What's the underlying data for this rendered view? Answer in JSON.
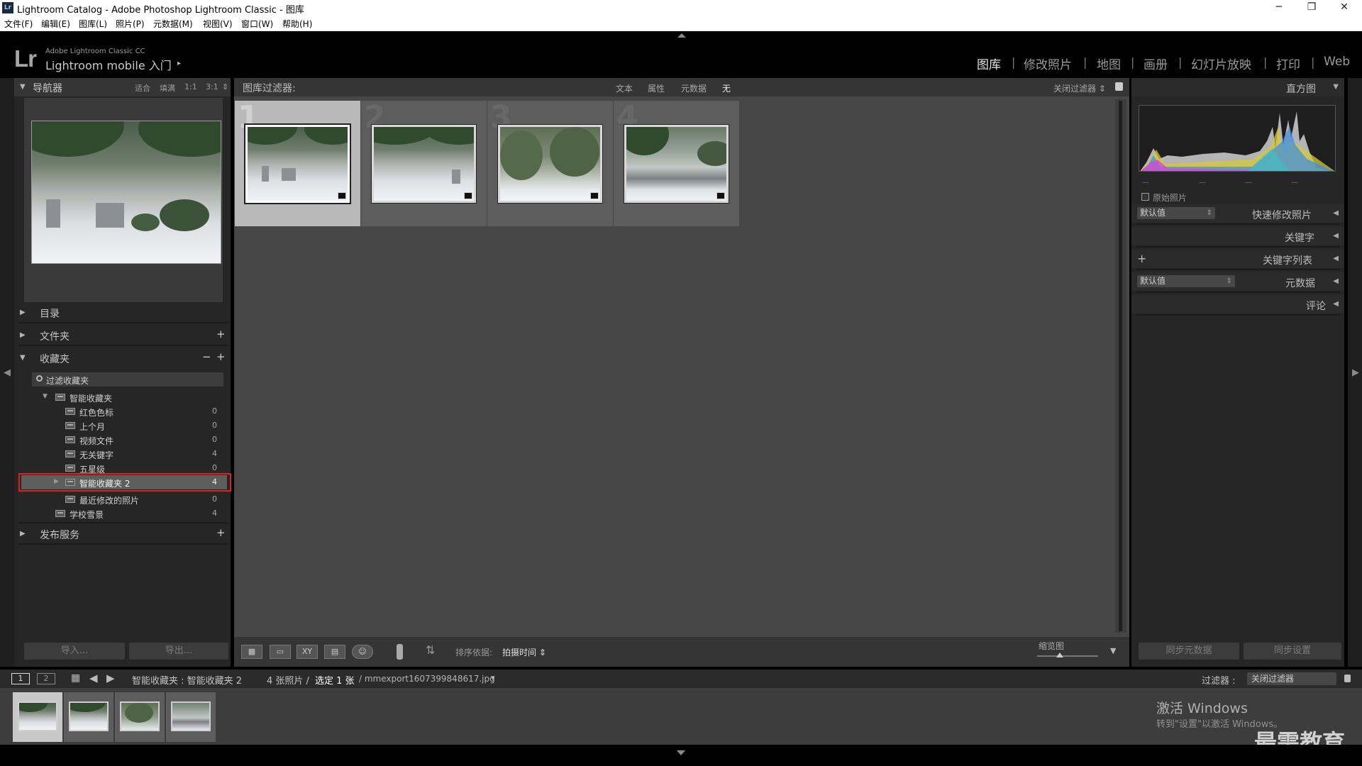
{
  "window": {
    "title": "Lightroom Catalog - Adobe Photoshop Lightroom Classic - 图库",
    "app_icon": "Lr",
    "controls": {
      "minimize": "─",
      "restore": "❐",
      "close": "✕"
    }
  },
  "menu": [
    "文件(F)",
    "编辑(E)",
    "图库(L)",
    "照片(P)",
    "元数据(M)",
    "视图(V)",
    "窗口(W)",
    "帮助(H)"
  ],
  "identity": {
    "logo": "Lr",
    "product": "Adobe Lightroom Classic CC",
    "tagline": "Lightroom mobile 入门",
    "arrow": "▸"
  },
  "modules": [
    {
      "label": "图库",
      "active": true
    },
    {
      "label": "修改照片",
      "active": false
    },
    {
      "label": "地图",
      "active": false
    },
    {
      "label": "画册",
      "active": false
    },
    {
      "label": "幻灯片放映",
      "active": false
    },
    {
      "label": "打印",
      "active": false
    },
    {
      "label": "Web",
      "active": false
    }
  ],
  "module_separator": "|",
  "navigator": {
    "title": "导航器",
    "zoom_options": [
      "适合",
      "填满",
      "1:1",
      "3:1"
    ],
    "stepper": "⇕"
  },
  "left_panels": {
    "catalog": "目录",
    "folders": "文件夹",
    "collections": "收藏夹",
    "publish": "发布服务",
    "plus": "+",
    "minus": "−",
    "collapsed": "▶",
    "expanded": "▼"
  },
  "collections": {
    "filter_label": "过滤收藏夹",
    "items": [
      {
        "name": "智能收藏夹",
        "count": "",
        "level": 0,
        "expanded": true,
        "selected": false
      },
      {
        "name": "红色色标",
        "count": "0",
        "level": 1,
        "selected": false
      },
      {
        "name": "上个月",
        "count": "0",
        "level": 1,
        "selected": false
      },
      {
        "name": "视频文件",
        "count": "0",
        "level": 1,
        "selected": false
      },
      {
        "name": "无关键字",
        "count": "4",
        "level": 1,
        "selected": false
      },
      {
        "name": "五星级",
        "count": "0",
        "level": 1,
        "selected": false
      },
      {
        "name": "智能收藏夹 2",
        "count": "4",
        "level": 1,
        "selected": true
      },
      {
        "name": "最近修改的照片",
        "count": "0",
        "level": 1,
        "selected": false
      },
      {
        "name": "学校雪景",
        "count": "4",
        "level": 0,
        "selected": false
      }
    ]
  },
  "left_buttons": {
    "import": "导入...",
    "export": "导出..."
  },
  "filter_bar": {
    "label": "图库过滤器:",
    "options": [
      "文本",
      "属性",
      "元数据",
      "无"
    ],
    "active": "无",
    "right": "关闭过滤器 ⇕"
  },
  "grid": {
    "cells": [
      {
        "num": "1",
        "selected": true
      },
      {
        "num": "2",
        "selected": false
      },
      {
        "num": "3",
        "selected": false
      },
      {
        "num": "4",
        "selected": false
      }
    ]
  },
  "toolbar": {
    "view_icons": [
      "grid-view",
      "loupe-view",
      "compare-view",
      "survey-view",
      "people-view"
    ],
    "compare_label": "XY",
    "sort_label": "排序依据:",
    "sort_value": "拍摄时间 ⇕",
    "thumb_label": "缩览图",
    "menu": "▼"
  },
  "right_panels": {
    "histogram": "直方图",
    "original": "原始照片",
    "quick_develop": "快速修改照片",
    "quick_preset": "默认值",
    "keywording": "关键字",
    "keyword_list": "关键字列表",
    "metadata": "元数据",
    "metadata_preset": "默认值",
    "comments": "评论",
    "histo_dashes": "—"
  },
  "right_buttons": {
    "sync_metadata": "同步元数据",
    "sync_settings": "同步设置"
  },
  "filmstrip": {
    "page1": "1",
    "page2": "2",
    "breadcrumb": "智能收藏夹 : 智能收藏夹 2",
    "count": "4 张照片 /",
    "selected": "选定 1 张",
    "filename": "/ mmexport1607399848617.jpg",
    "file_arrow": "▾",
    "filter_label": "过滤器 :",
    "filter_value": "关闭过滤器",
    "cells": [
      {
        "selected": true
      },
      {
        "selected": false
      },
      {
        "selected": false
      },
      {
        "selected": false
      }
    ]
  },
  "overlay": {
    "activate_title": "激活 Windows",
    "activate_sub": "转到\"设置\"以激活 Windows。",
    "watermark": "最需教育"
  },
  "colors": {
    "accent_red": "#e02020",
    "panel": "#262626",
    "grid_bg": "#474747"
  }
}
